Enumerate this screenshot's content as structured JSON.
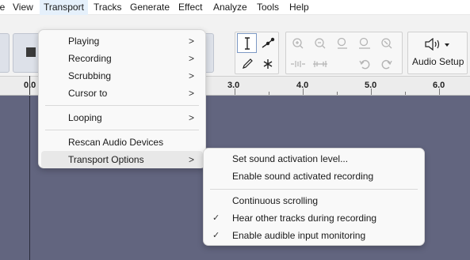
{
  "menubar": {
    "items": [
      "File",
      "View",
      "Transport",
      "Tracks",
      "Generate",
      "Effect",
      "Analyze",
      "Tools",
      "Help"
    ]
  },
  "ruler": {
    "labels": [
      "0.0",
      "3.0",
      "4.0",
      "5.0",
      "6.0"
    ]
  },
  "toolbar": {
    "audio_setup_label": "Audio Setup"
  },
  "transport_menu": {
    "items": [
      {
        "label": "Playing",
        "submenu": true
      },
      {
        "label": "Recording",
        "submenu": true
      },
      {
        "label": "Scrubbing",
        "submenu": true
      },
      {
        "label": "Cursor to",
        "submenu": true
      },
      {
        "label": "Looping",
        "submenu": true
      },
      {
        "label": "Rescan Audio Devices",
        "submenu": false
      },
      {
        "label": "Transport Options",
        "submenu": true
      }
    ],
    "arrow_glyph": ">"
  },
  "options_submenu": {
    "items": [
      {
        "label": "Set sound activation level...",
        "checked": false
      },
      {
        "label": "Enable sound activated recording",
        "checked": false
      },
      {
        "label": "Continuous scrolling",
        "checked": false
      },
      {
        "label": "Hear other tracks during recording",
        "checked": true
      },
      {
        "label": "Enable audible input monitoring",
        "checked": true
      }
    ],
    "check_glyph": "✓"
  },
  "colors": {
    "track_area": "#62657f",
    "menu_bg": "#f9f9f9",
    "active_menu": "#e5f0fb"
  }
}
